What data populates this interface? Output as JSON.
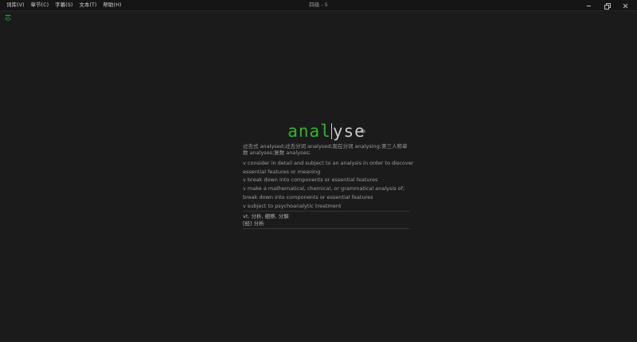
{
  "menu": {
    "items": [
      "词库(V)",
      "章节(C)",
      "字幕(S)",
      "文本(T)",
      "帮助(H)"
    ]
  },
  "window": {
    "title": "四级 - 5"
  },
  "progress": {
    "label": "芯"
  },
  "word": {
    "typed": "anal",
    "remaining": "yse",
    "inflections": "过去式 analysed;过去分词 analysed;现在分词 analysing;第三人称单数 analyses;复数 analyses;",
    "definitions": [
      "v consider in detail and subject to an analysis in order to discover",
      "essential features or meaning",
      "v break down into components or essential features",
      "v make a mathematical, chemical, or grammatical analysis of;",
      "break down into components or essential features",
      "v subject to psychoanalytic treatment"
    ],
    "translations": [
      "vt. 分析, 细察, 分解",
      "[经] 分析"
    ]
  },
  "colors": {
    "typed": "#2fb52f",
    "remaining": "#c9c9c9",
    "background": "#1b1b1b"
  }
}
